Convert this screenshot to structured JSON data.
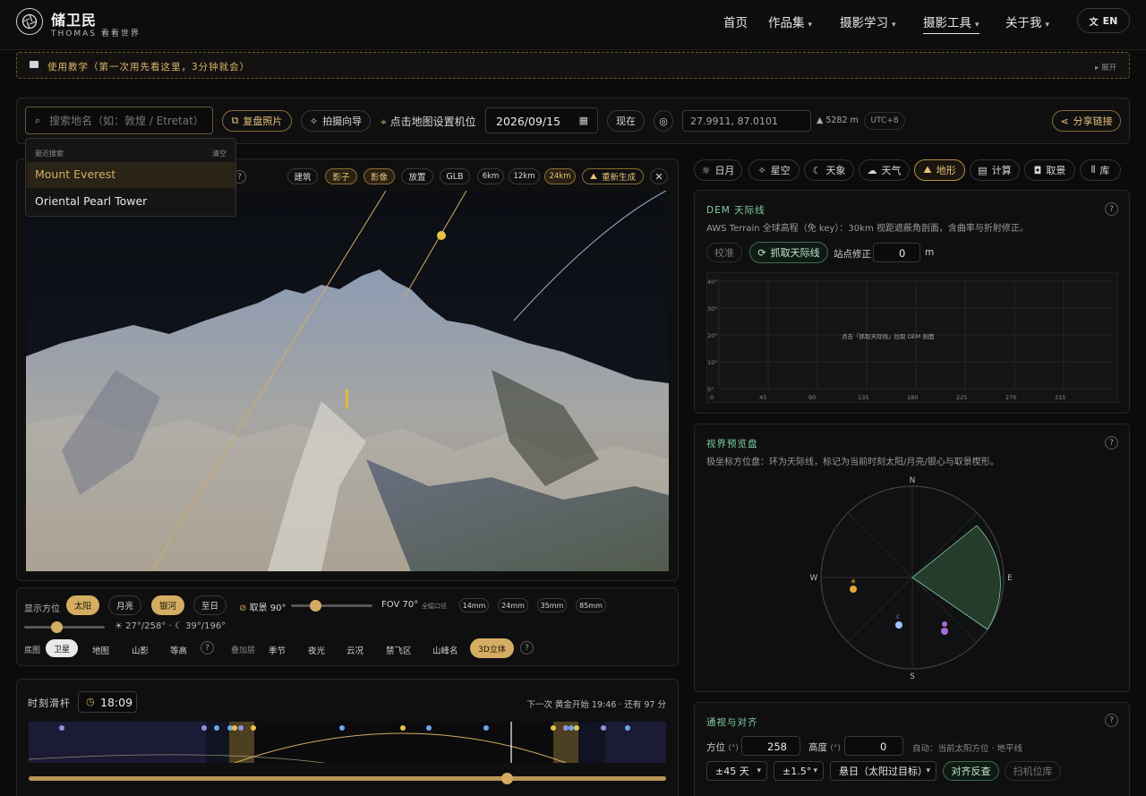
{
  "nav": {
    "brand_name": "储卫民",
    "brand_sub": "THOMAS 看看世界",
    "items": [
      "首页",
      "作品集",
      "摄影学习",
      "摄影工具",
      "关于我"
    ],
    "lang_label": "EN"
  },
  "tutorial": {
    "text": "使用教学（第一次用先看这里，3分钟就会）",
    "expand": "展开"
  },
  "toolbar": {
    "search_placeholder": "搜索地名（如：敦煌 / Etretat）",
    "replicate_button": "复盘照片",
    "guide_button": "拍摄向导",
    "set_position": "点击地图设置机位",
    "date": "2026/09/15",
    "now_button": "现在",
    "coords": "27.9911, 87.0101",
    "elevation": "5282 m",
    "utc": "UTC+8",
    "share_button": "分享链接"
  },
  "search_dropdown": {
    "header": "最近搜索",
    "clear": "清空",
    "items": [
      "Mount Everest",
      "Oriental Pearl Tower"
    ]
  },
  "map_toolbar": {
    "buttons": [
      "建筑",
      "影子",
      "影像",
      "放置",
      "GLB",
      "6km",
      "12km",
      "24km"
    ],
    "regenerate": "重新生成"
  },
  "display_controls": {
    "label": "显示方位",
    "buttons": [
      "太阳",
      "月亮",
      "银河",
      "至日"
    ],
    "view_label": "取景 90°",
    "fov_label": "FOV 70°",
    "fullframe": "全幅口径",
    "lenses": [
      "14mm",
      "24mm",
      "35mm",
      "85mm"
    ],
    "sun_moon_readout": "☀ 27°/258° · ☾ 39°/196°",
    "view_slider_value": 0.3,
    "top_slider_value": 0.4
  },
  "layers": {
    "base_label": "底图",
    "base_items": [
      "卫星",
      "地图",
      "山影",
      "等高"
    ],
    "overlay_label": "叠加层",
    "overlay_items": [
      "季节",
      "夜光",
      "云况",
      "禁飞区",
      "山峰名",
      "3D立体"
    ]
  },
  "time_panel": {
    "label": "时刻滑杆",
    "time": "18:09",
    "next_event": "下一次 黄金开始 19:46 · 还有 97 分",
    "slider_value": 0.75
  },
  "right_tabs": [
    "日月",
    "星空",
    "天象",
    "天气",
    "地形",
    "计算",
    "取景",
    "库"
  ],
  "dem": {
    "title": "DEM 天际线",
    "desc": "AWS Terrain 全球高程（免 key）：30km 视距遮蔽角剖面，含曲率与折射修正。",
    "calibrate": "校准",
    "fetch_button": "抓取天际线",
    "station_label": "站点修正",
    "station_value": "0",
    "unit": "m",
    "chart_hint": "点击「抓取天际线」拉取 DEM 剖面"
  },
  "chart_data": {
    "type": "line",
    "title": "",
    "xlabel": "",
    "ylabel": "",
    "x_ticks": [
      "0",
      "45",
      "90",
      "135",
      "180",
      "225",
      "270",
      "315"
    ],
    "y_ticks": [
      "0°",
      "10°",
      "20°",
      "30°",
      "40°"
    ],
    "xlim": [
      0,
      360
    ],
    "ylim": [
      0,
      40
    ],
    "series": []
  },
  "view_preview": {
    "title": "视界预览盘",
    "desc": "极坐标方位盘：环为天际线，标记为当前时刻太阳/月亮/银心与取景楔形。",
    "compass": [
      "N",
      "E",
      "S",
      "W"
    ]
  },
  "align": {
    "title": "通视与对齐",
    "azimuth_label": "方位",
    "azimuth_unit": "(°)",
    "azimuth_value": "258",
    "altitude_label": "高度",
    "altitude_unit": "(°)",
    "altitude_value": "0",
    "auto_text": "自动：当前太阳方位 · 地平线",
    "days_select": "±45 天",
    "deg_select": "±1.5°",
    "mode_select": "悬日（太阳过目标）",
    "reverse_button": "对齐反查",
    "scan_button": "扫机位库"
  },
  "colors": {
    "accent": "#d4ad62",
    "green": "#7fcfa2"
  }
}
